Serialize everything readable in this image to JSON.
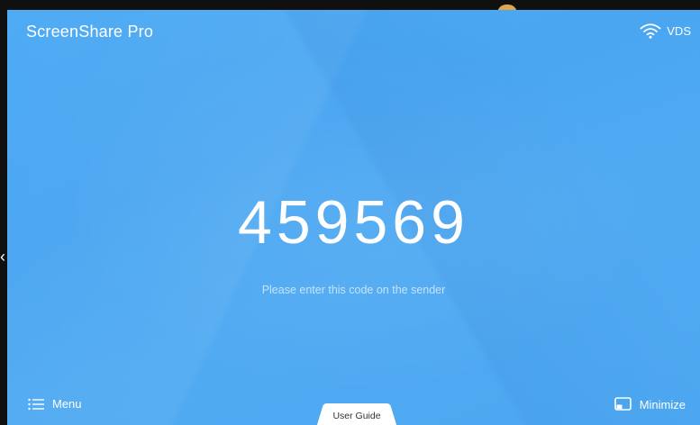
{
  "app": {
    "title": "ScreenShare Pro"
  },
  "status": {
    "network_icon": "wifi-icon",
    "network_name": "VDS"
  },
  "pairing": {
    "code": "459569",
    "hint": "Please enter this code on the sender"
  },
  "footer": {
    "menu_icon": "menu-list-icon",
    "menu_label": "Menu",
    "guide_label": "User Guide",
    "minimize_icon": "minimize-window-icon",
    "minimize_label": "Minimize"
  },
  "colors": {
    "background": "#4ea8f2",
    "text": "#ffffff",
    "hint_text": "#d8ecff",
    "guide_tab": "#ffffff"
  }
}
